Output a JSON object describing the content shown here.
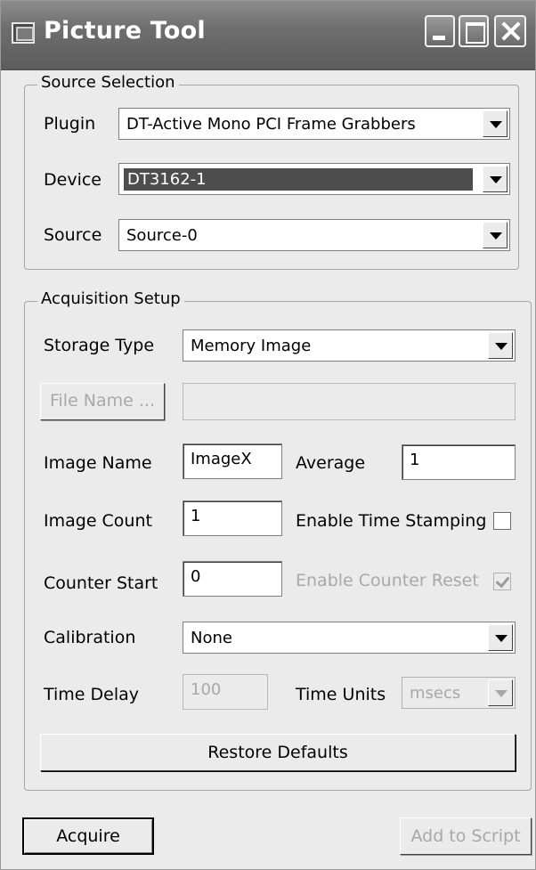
{
  "window": {
    "title": "Picture Tool"
  },
  "source_selection": {
    "legend": "Source Selection",
    "plugin": {
      "label": "Plugin",
      "value": "DT-Active Mono PCI Frame Grabbers"
    },
    "device": {
      "label": "Device",
      "value": "DT3162-1"
    },
    "source": {
      "label": "Source",
      "value": "Source-0"
    }
  },
  "acquisition_setup": {
    "legend": "Acquisition Setup",
    "storage_type": {
      "label": "Storage Type",
      "value": "Memory Image"
    },
    "file_name": {
      "button_label": "File Name ...",
      "value": ""
    },
    "image_name": {
      "label": "Image Name",
      "value": "ImageX"
    },
    "average": {
      "label": "Average",
      "value": "1"
    },
    "image_count": {
      "label": "Image Count",
      "value": "1"
    },
    "enable_time_stamping": {
      "label": "Enable Time Stamping",
      "checked": false
    },
    "counter_start": {
      "label": "Counter Start",
      "value": "0"
    },
    "enable_counter_reset": {
      "label": "Enable Counter Reset",
      "checked": true
    },
    "calibration": {
      "label": "Calibration",
      "value": "None"
    },
    "time_delay": {
      "label": "Time Delay",
      "value": "100"
    },
    "time_units": {
      "label": "Time Units",
      "value": "msecs"
    },
    "restore_defaults_label": "Restore Defaults"
  },
  "footer": {
    "acquire_label": "Acquire",
    "add_to_script_label": "Add to Script"
  }
}
